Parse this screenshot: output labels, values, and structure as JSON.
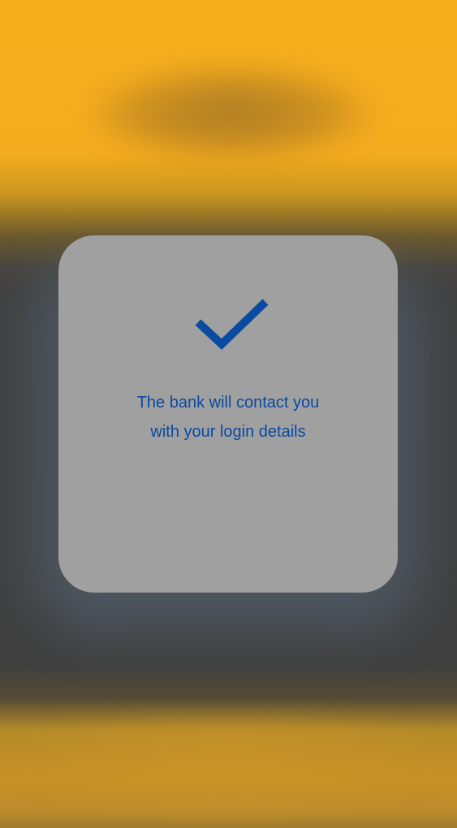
{
  "dialog": {
    "icon": "checkmark-icon",
    "message_line1": "The bank will contact you",
    "message_line2": "with your login details",
    "accent_color": "#0a4aa0",
    "card_color": "#a0a0a0"
  },
  "background": {
    "brand_color": "#f7ae1d",
    "overlay_color": "#404040"
  }
}
